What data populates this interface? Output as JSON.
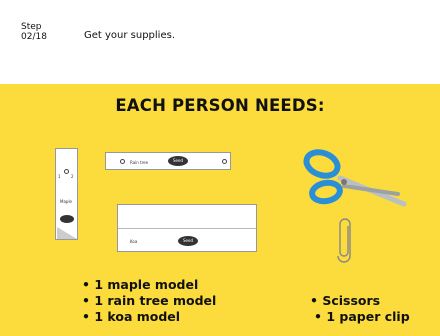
{
  "header": {
    "step_label": "Step",
    "step_count": "02/18",
    "instruction": "Get your supplies."
  },
  "panel": {
    "heading": "EACH PERSON NEEDS:",
    "maple": {
      "label": "Maple",
      "numbers": [
        "1",
        "2"
      ]
    },
    "rain_tree": {
      "label": "Rain tree",
      "seed": "Seed"
    },
    "koa": {
      "label": "Koa",
      "seed": "Seed"
    },
    "models_list": [
      "1 maple model",
      "1 rain tree model",
      "1 koa model"
    ],
    "tools_list": [
      "Scissors",
      "1 paper clip"
    ],
    "colors": {
      "background": "#fbdc3c",
      "scissor_handle": "#2a8fd6"
    }
  }
}
